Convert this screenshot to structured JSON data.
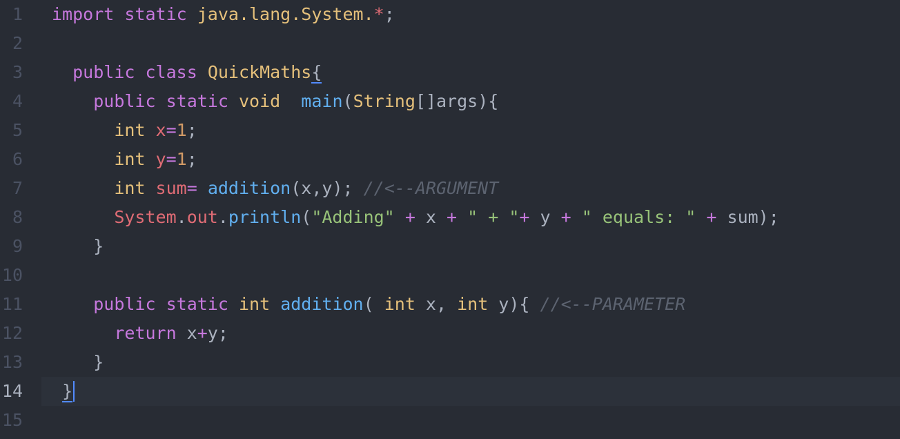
{
  "editor": {
    "language": "java",
    "active_line": 14,
    "colors": {
      "background": "#282c34",
      "active_line_background": "#2c313a",
      "line_number": "#4b5263",
      "keyword": "#c678dd",
      "type": "#e5c07b",
      "function": "#61afef",
      "string": "#98c379",
      "number": "#d19a66",
      "variable": "#e06c75",
      "comment": "#5c6370",
      "plain": "#abb2bf",
      "bracket_match": "#528bff"
    },
    "line_numbers": [
      "1",
      "2",
      "3",
      "4",
      "5",
      "6",
      "7",
      "8",
      "9",
      "10",
      "11",
      "12",
      "13",
      "14",
      "15"
    ],
    "lines": [
      {
        "indent": "",
        "tokens": [
          {
            "t": "import",
            "c": "keyword"
          },
          {
            "t": " ",
            "c": "plain"
          },
          {
            "t": "static",
            "c": "keyword"
          },
          {
            "t": " ",
            "c": "plain"
          },
          {
            "t": "java.lang.System.",
            "c": "type"
          },
          {
            "t": "*",
            "c": "variable"
          },
          {
            "t": ";",
            "c": "plain"
          }
        ]
      },
      {
        "indent": "",
        "tokens": []
      },
      {
        "indent": "  ",
        "tokens": [
          {
            "t": "public",
            "c": "keyword"
          },
          {
            "t": " ",
            "c": "plain"
          },
          {
            "t": "class",
            "c": "keyword"
          },
          {
            "t": " ",
            "c": "plain"
          },
          {
            "t": "QuickMaths",
            "c": "class"
          },
          {
            "t": "{",
            "c": "plain",
            "match": true
          }
        ]
      },
      {
        "indent": "    ",
        "tokens": [
          {
            "t": "public",
            "c": "keyword"
          },
          {
            "t": " ",
            "c": "plain"
          },
          {
            "t": "static",
            "c": "keyword"
          },
          {
            "t": " ",
            "c": "plain"
          },
          {
            "t": "void",
            "c": "type"
          },
          {
            "t": "  ",
            "c": "plain"
          },
          {
            "t": "main",
            "c": "function"
          },
          {
            "t": "(",
            "c": "plain"
          },
          {
            "t": "String",
            "c": "type"
          },
          {
            "t": "[]args){",
            "c": "plain"
          }
        ]
      },
      {
        "indent": "      ",
        "tokens": [
          {
            "t": "int",
            "c": "type"
          },
          {
            "t": " ",
            "c": "plain"
          },
          {
            "t": "x",
            "c": "variable"
          },
          {
            "t": "=",
            "c": "operator"
          },
          {
            "t": "1",
            "c": "number"
          },
          {
            "t": ";",
            "c": "plain"
          }
        ]
      },
      {
        "indent": "      ",
        "tokens": [
          {
            "t": "int",
            "c": "type"
          },
          {
            "t": " ",
            "c": "plain"
          },
          {
            "t": "y",
            "c": "variable"
          },
          {
            "t": "=",
            "c": "operator"
          },
          {
            "t": "1",
            "c": "number"
          },
          {
            "t": ";",
            "c": "plain"
          }
        ]
      },
      {
        "indent": "      ",
        "tokens": [
          {
            "t": "int",
            "c": "type"
          },
          {
            "t": " ",
            "c": "plain"
          },
          {
            "t": "sum",
            "c": "variable"
          },
          {
            "t": "=",
            "c": "operator"
          },
          {
            "t": " ",
            "c": "plain"
          },
          {
            "t": "addition",
            "c": "function"
          },
          {
            "t": "(x,y); ",
            "c": "plain"
          },
          {
            "t": "//<--ARGUMENT",
            "c": "comment"
          }
        ]
      },
      {
        "indent": "      ",
        "tokens": [
          {
            "t": "System",
            "c": "variable"
          },
          {
            "t": ".",
            "c": "plain"
          },
          {
            "t": "out",
            "c": "variable"
          },
          {
            "t": ".",
            "c": "plain"
          },
          {
            "t": "println",
            "c": "function"
          },
          {
            "t": "(",
            "c": "plain"
          },
          {
            "t": "\"Adding\"",
            "c": "string"
          },
          {
            "t": " ",
            "c": "plain"
          },
          {
            "t": "+",
            "c": "operator"
          },
          {
            "t": " x ",
            "c": "plain"
          },
          {
            "t": "+",
            "c": "operator"
          },
          {
            "t": " ",
            "c": "plain"
          },
          {
            "t": "\" + \"",
            "c": "string"
          },
          {
            "t": "+",
            "c": "operator"
          },
          {
            "t": " y ",
            "c": "plain"
          },
          {
            "t": "+",
            "c": "operator"
          },
          {
            "t": " ",
            "c": "plain"
          },
          {
            "t": "\" equals: \"",
            "c": "string"
          },
          {
            "t": " ",
            "c": "plain"
          },
          {
            "t": "+",
            "c": "operator"
          },
          {
            "t": " sum);",
            "c": "plain"
          }
        ]
      },
      {
        "indent": "    ",
        "tokens": [
          {
            "t": "}",
            "c": "plain"
          }
        ]
      },
      {
        "indent": "",
        "tokens": []
      },
      {
        "indent": "    ",
        "tokens": [
          {
            "t": "public",
            "c": "keyword"
          },
          {
            "t": " ",
            "c": "plain"
          },
          {
            "t": "static",
            "c": "keyword"
          },
          {
            "t": " ",
            "c": "plain"
          },
          {
            "t": "int",
            "c": "type"
          },
          {
            "t": " ",
            "c": "plain"
          },
          {
            "t": "addition",
            "c": "function"
          },
          {
            "t": "( ",
            "c": "plain"
          },
          {
            "t": "int",
            "c": "type"
          },
          {
            "t": " x, ",
            "c": "plain"
          },
          {
            "t": "int",
            "c": "type"
          },
          {
            "t": " y){ ",
            "c": "plain"
          },
          {
            "t": "//<--PARAMETER",
            "c": "comment"
          }
        ]
      },
      {
        "indent": "      ",
        "tokens": [
          {
            "t": "return",
            "c": "keyword"
          },
          {
            "t": " x",
            "c": "plain"
          },
          {
            "t": "+",
            "c": "operator"
          },
          {
            "t": "y;",
            "c": "plain"
          }
        ]
      },
      {
        "indent": "    ",
        "tokens": [
          {
            "t": "}",
            "c": "plain"
          }
        ]
      },
      {
        "indent": " ",
        "tokens": [
          {
            "t": "}",
            "c": "plain",
            "match": true
          }
        ]
      },
      {
        "indent": "",
        "tokens": []
      }
    ]
  }
}
